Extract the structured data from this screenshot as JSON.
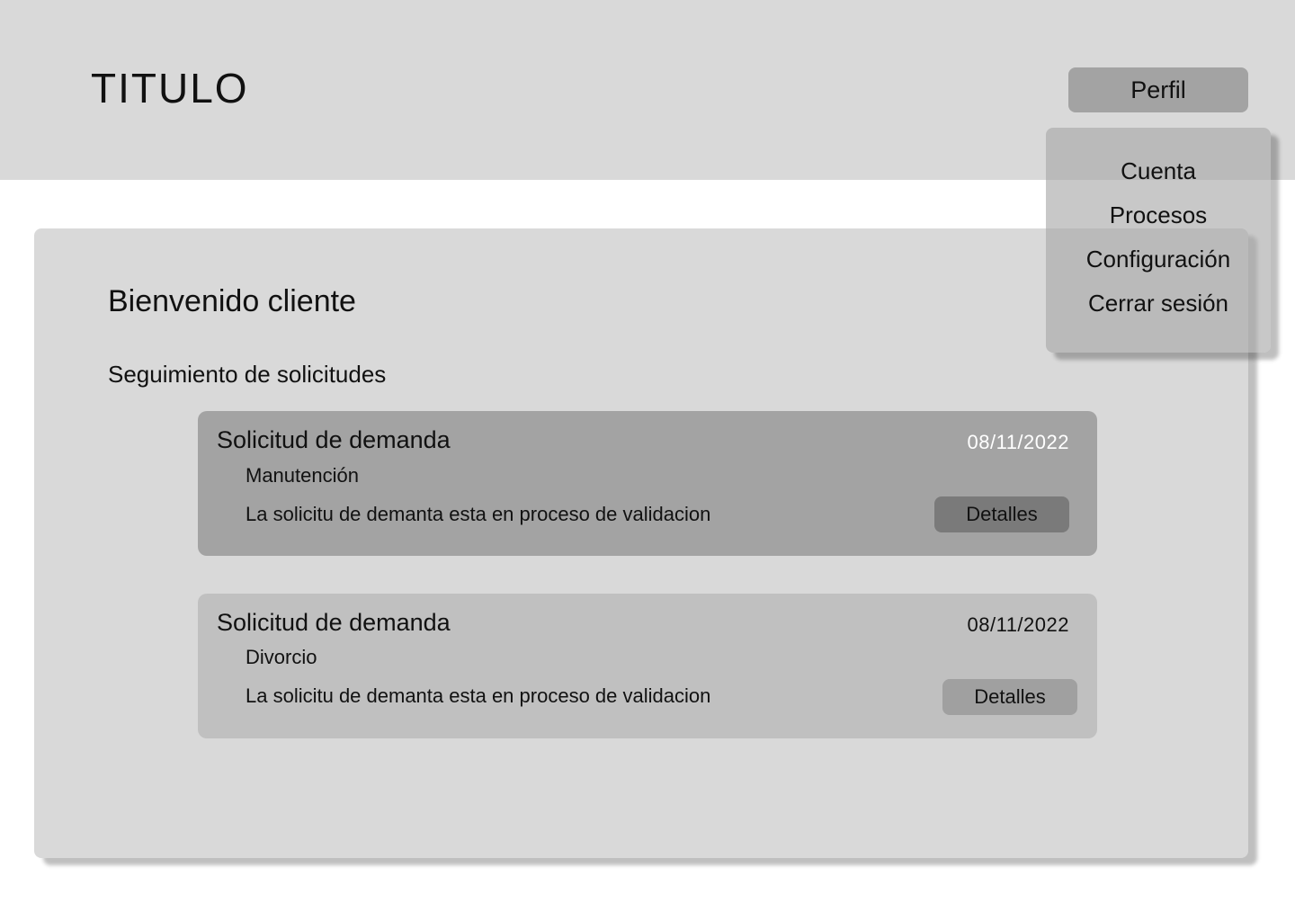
{
  "header": {
    "title": "TITULO",
    "profile_label": "Perfil"
  },
  "profile_menu": {
    "items": [
      {
        "label": "Cuenta"
      },
      {
        "label": "Procesos"
      },
      {
        "label": "Configuración"
      },
      {
        "label": "Cerrar sesión"
      }
    ]
  },
  "main": {
    "welcome": "Bienvenido cliente",
    "section_title": "Seguimiento de solicitudes",
    "requests": [
      {
        "title": "Solicitud de demanda",
        "date": "08/11/2022",
        "category": "Manutención",
        "status": "La solicitu de demanta esta en proceso de validacion",
        "details_label": "Detalles"
      },
      {
        "title": "Solicitud de demanda",
        "date": "08/11/2022",
        "category": "Divorcio",
        "status": "La solicitu de demanta esta en proceso de validacion",
        "details_label": "Detalles"
      }
    ]
  },
  "colors": {
    "header_bg": "#d9d9d9",
    "panel_bg": "#d9d9d9",
    "card_active_bg": "#a3a3a3",
    "card_bg": "#c0c0c0",
    "button_dark": "#7a7a7a",
    "button_mid": "#a0a0a0"
  }
}
